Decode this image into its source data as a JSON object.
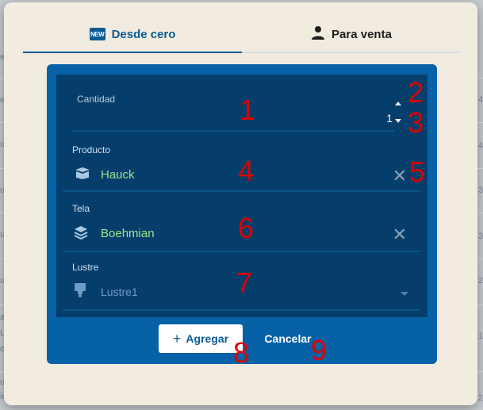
{
  "background": {
    "left_fragments": [
      "e",
      "ep",
      "u",
      "u",
      "u",
      "us",
      "a",
      "L",
      "o",
      "u",
      "ie"
    ],
    "right_fragments": [
      "4",
      "4",
      "3",
      "3",
      "2",
      "1",
      "2.0"
    ]
  },
  "tabs": [
    {
      "label": "Desde cero",
      "icon": "new-icon",
      "icon_text": "NEW",
      "active": true
    },
    {
      "label": "Para venta",
      "icon": "person-icon",
      "active": false
    }
  ],
  "form": {
    "cantidad": {
      "label": "Cantidad",
      "value": "1"
    },
    "producto": {
      "label": "Producto",
      "value": "Hauck",
      "icon": "box-icon"
    },
    "tela": {
      "label": "Tela",
      "value": "Boehmian",
      "icon": "layers-icon"
    },
    "lustre": {
      "label": "Lustre",
      "value": "Lustre1",
      "icon": "lamp-icon"
    }
  },
  "buttons": {
    "add_label": "Agregar",
    "add_icon": "plus-icon",
    "cancel_label": "Cancelar"
  },
  "annotations": [
    "1",
    "2",
    "3",
    "4",
    "5",
    "6",
    "7",
    "8",
    "9"
  ],
  "colors": {
    "accent": "#0b5b95",
    "panel": "#0761a6",
    "form_bg": "#063e6b",
    "value_text": "#9ce68e",
    "annotation": "#e00000"
  }
}
